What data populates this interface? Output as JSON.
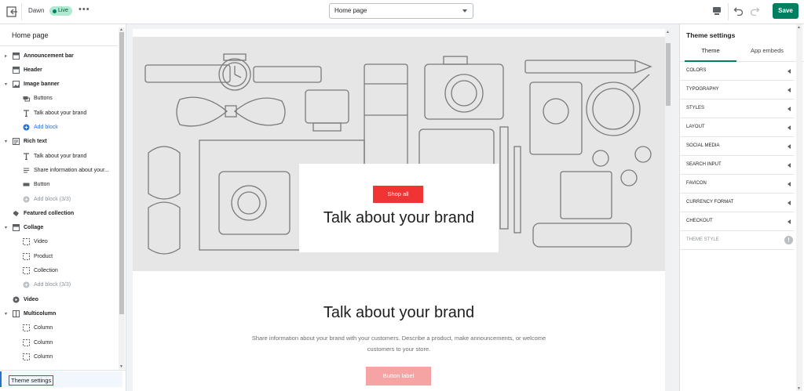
{
  "topbar": {
    "theme_name": "Dawn",
    "status_badge": "Live",
    "more_label": "•••",
    "page_select": "Home page",
    "save_label": "Save"
  },
  "left_panel": {
    "title": "Home page",
    "tree": [
      {
        "kind": "section",
        "label": "Announcement bar",
        "icon": "section-icon",
        "caret": "▸"
      },
      {
        "kind": "section",
        "label": "Header",
        "icon": "section-icon",
        "caret": ""
      },
      {
        "kind": "section",
        "label": "Image banner",
        "icon": "image-icon",
        "caret": "▾"
      },
      {
        "kind": "block",
        "label": "Buttons",
        "icon": "buttons-icon"
      },
      {
        "kind": "block",
        "label": "Talk about your brand",
        "icon": "text-icon"
      },
      {
        "kind": "add",
        "label": "Add block",
        "icon": "plus-circle-icon"
      },
      {
        "kind": "section",
        "label": "Rich text",
        "icon": "text-block-icon",
        "caret": "▾"
      },
      {
        "kind": "block",
        "label": "Talk about your brand",
        "icon": "text-icon"
      },
      {
        "kind": "block",
        "label": "Share information about your...",
        "icon": "paragraph-icon"
      },
      {
        "kind": "block",
        "label": "Button",
        "icon": "button-icon"
      },
      {
        "kind": "add-disabled",
        "label": "Add block (3/3)",
        "icon": "plus-circle-icon"
      },
      {
        "kind": "section",
        "label": "Featured collection",
        "icon": "collection-icon",
        "caret": ""
      },
      {
        "kind": "section",
        "label": "Collage",
        "icon": "collage-icon",
        "caret": "▾"
      },
      {
        "kind": "block",
        "label": "Video",
        "icon": "dashed-square-icon"
      },
      {
        "kind": "block",
        "label": "Product",
        "icon": "dashed-square-icon"
      },
      {
        "kind": "block",
        "label": "Collection",
        "icon": "dashed-square-icon"
      },
      {
        "kind": "add-disabled",
        "label": "Add block (3/3)",
        "icon": "plus-circle-icon"
      },
      {
        "kind": "section",
        "label": "Video",
        "icon": "play-icon",
        "caret": ""
      },
      {
        "kind": "section",
        "label": "Multicolumn",
        "icon": "columns-icon",
        "caret": "▾"
      },
      {
        "kind": "block",
        "label": "Column",
        "icon": "dashed-square-icon"
      },
      {
        "kind": "block",
        "label": "Column",
        "icon": "dashed-square-icon"
      },
      {
        "kind": "block",
        "label": "Column",
        "icon": "dashed-square-icon"
      }
    ],
    "footer_label": "Theme settings"
  },
  "preview": {
    "banner_button": "Shop all",
    "banner_heading": "Talk about your brand",
    "rich_heading": "Talk about your brand",
    "rich_text": "Share information about your brand with your customers. Describe a product, make announcements, or welcome customers to your store.",
    "rich_button": "Button label"
  },
  "right_panel": {
    "title": "Theme settings",
    "tabs": [
      "Theme",
      "App embeds"
    ],
    "settings": [
      "COLORS",
      "TYPOGRAPHY",
      "STYLES",
      "LAYOUT",
      "SOCIAL MEDIA",
      "SEARCH INPUT",
      "FAVICON",
      "CURRENCY FORMAT",
      "CHECKOUT"
    ],
    "theme_style_label": "THEME STYLE",
    "info_glyph": "!"
  },
  "colors": {
    "save": "#008060",
    "live_badge": "#aee9d1",
    "banner_button": "#f03434",
    "rich_button": "#f5a3a3",
    "highlight": "#d72c0d"
  }
}
